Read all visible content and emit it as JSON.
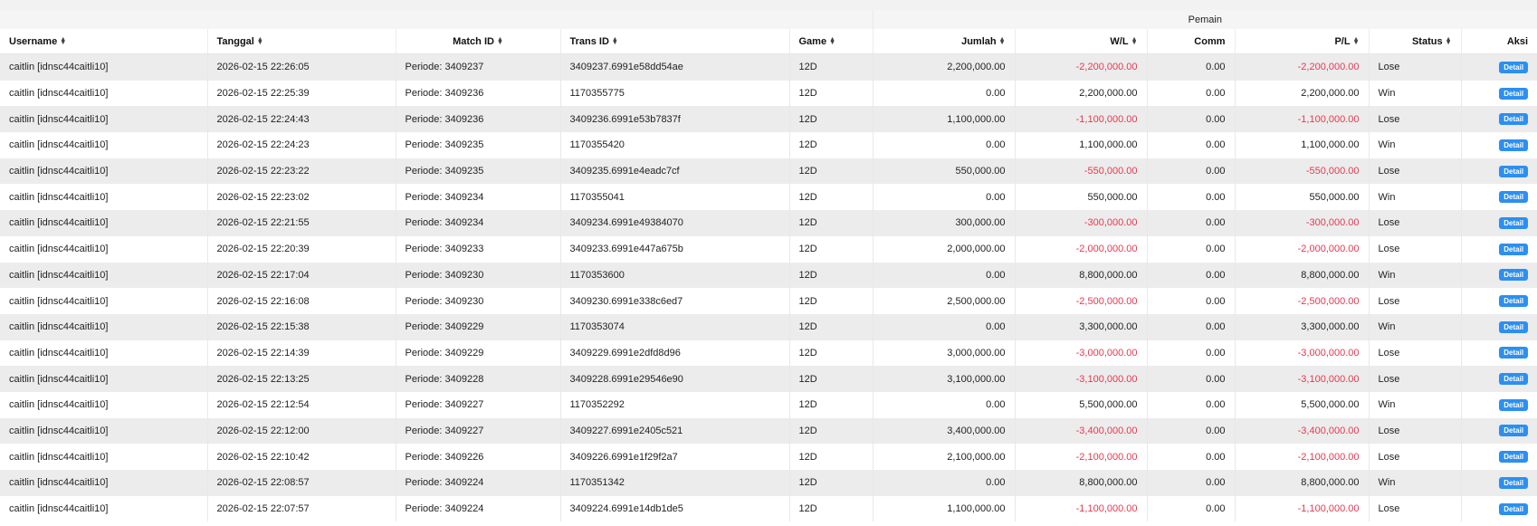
{
  "header_group": {
    "pemain": "Pemain"
  },
  "columns": [
    "Username",
    "Tanggal",
    "Match ID",
    "Trans ID",
    "Game",
    "Jumlah",
    "W/L",
    "Comm",
    "P/L",
    "Status",
    "Aksi"
  ],
  "sort_icon": "sort-icon",
  "colors": {
    "negative": "#e8384f",
    "detail_button": "#2d8ff0",
    "row_alt": "#ececec"
  },
  "rows": [
    {
      "username": "caitlin [idnsc44caitli10]",
      "tanggal": "2026-02-15 22:26:05",
      "match_id": "Periode: 3409237",
      "trans_id": "3409237.6991e58dd54ae",
      "game": "12D",
      "jumlah": "2,200,000.00",
      "wl": "-2,200,000.00",
      "comm": "0.00",
      "pl": "-2,200,000.00",
      "status": "Lose",
      "aksi": "Detail"
    },
    {
      "username": "caitlin [idnsc44caitli10]",
      "tanggal": "2026-02-15 22:25:39",
      "match_id": "Periode: 3409236",
      "trans_id": "1170355775",
      "game": "12D",
      "jumlah": "0.00",
      "wl": "2,200,000.00",
      "comm": "0.00",
      "pl": "2,200,000.00",
      "status": "Win",
      "aksi": "Detail"
    },
    {
      "username": "caitlin [idnsc44caitli10]",
      "tanggal": "2026-02-15 22:24:43",
      "match_id": "Periode: 3409236",
      "trans_id": "3409236.6991e53b7837f",
      "game": "12D",
      "jumlah": "1,100,000.00",
      "wl": "-1,100,000.00",
      "comm": "0.00",
      "pl": "-1,100,000.00",
      "status": "Lose",
      "aksi": "Detail"
    },
    {
      "username": "caitlin [idnsc44caitli10]",
      "tanggal": "2026-02-15 22:24:23",
      "match_id": "Periode: 3409235",
      "trans_id": "1170355420",
      "game": "12D",
      "jumlah": "0.00",
      "wl": "1,100,000.00",
      "comm": "0.00",
      "pl": "1,100,000.00",
      "status": "Win",
      "aksi": "Detail"
    },
    {
      "username": "caitlin [idnsc44caitli10]",
      "tanggal": "2026-02-15 22:23:22",
      "match_id": "Periode: 3409235",
      "trans_id": "3409235.6991e4eadc7cf",
      "game": "12D",
      "jumlah": "550,000.00",
      "wl": "-550,000.00",
      "comm": "0.00",
      "pl": "-550,000.00",
      "status": "Lose",
      "aksi": "Detail"
    },
    {
      "username": "caitlin [idnsc44caitli10]",
      "tanggal": "2026-02-15 22:23:02",
      "match_id": "Periode: 3409234",
      "trans_id": "1170355041",
      "game": "12D",
      "jumlah": "0.00",
      "wl": "550,000.00",
      "comm": "0.00",
      "pl": "550,000.00",
      "status": "Win",
      "aksi": "Detail"
    },
    {
      "username": "caitlin [idnsc44caitli10]",
      "tanggal": "2026-02-15 22:21:55",
      "match_id": "Periode: 3409234",
      "trans_id": "3409234.6991e49384070",
      "game": "12D",
      "jumlah": "300,000.00",
      "wl": "-300,000.00",
      "comm": "0.00",
      "pl": "-300,000.00",
      "status": "Lose",
      "aksi": "Detail"
    },
    {
      "username": "caitlin [idnsc44caitli10]",
      "tanggal": "2026-02-15 22:20:39",
      "match_id": "Periode: 3409233",
      "trans_id": "3409233.6991e447a675b",
      "game": "12D",
      "jumlah": "2,000,000.00",
      "wl": "-2,000,000.00",
      "comm": "0.00",
      "pl": "-2,000,000.00",
      "status": "Lose",
      "aksi": "Detail"
    },
    {
      "username": "caitlin [idnsc44caitli10]",
      "tanggal": "2026-02-15 22:17:04",
      "match_id": "Periode: 3409230",
      "trans_id": "1170353600",
      "game": "12D",
      "jumlah": "0.00",
      "wl": "8,800,000.00",
      "comm": "0.00",
      "pl": "8,800,000.00",
      "status": "Win",
      "aksi": "Detail"
    },
    {
      "username": "caitlin [idnsc44caitli10]",
      "tanggal": "2026-02-15 22:16:08",
      "match_id": "Periode: 3409230",
      "trans_id": "3409230.6991e338c6ed7",
      "game": "12D",
      "jumlah": "2,500,000.00",
      "wl": "-2,500,000.00",
      "comm": "0.00",
      "pl": "-2,500,000.00",
      "status": "Lose",
      "aksi": "Detail"
    },
    {
      "username": "caitlin [idnsc44caitli10]",
      "tanggal": "2026-02-15 22:15:38",
      "match_id": "Periode: 3409229",
      "trans_id": "1170353074",
      "game": "12D",
      "jumlah": "0.00",
      "wl": "3,300,000.00",
      "comm": "0.00",
      "pl": "3,300,000.00",
      "status": "Win",
      "aksi": "Detail"
    },
    {
      "username": "caitlin [idnsc44caitli10]",
      "tanggal": "2026-02-15 22:14:39",
      "match_id": "Periode: 3409229",
      "trans_id": "3409229.6991e2dfd8d96",
      "game": "12D",
      "jumlah": "3,000,000.00",
      "wl": "-3,000,000.00",
      "comm": "0.00",
      "pl": "-3,000,000.00",
      "status": "Lose",
      "aksi": "Detail"
    },
    {
      "username": "caitlin [idnsc44caitli10]",
      "tanggal": "2026-02-15 22:13:25",
      "match_id": "Periode: 3409228",
      "trans_id": "3409228.6991e29546e90",
      "game": "12D",
      "jumlah": "3,100,000.00",
      "wl": "-3,100,000.00",
      "comm": "0.00",
      "pl": "-3,100,000.00",
      "status": "Lose",
      "aksi": "Detail"
    },
    {
      "username": "caitlin [idnsc44caitli10]",
      "tanggal": "2026-02-15 22:12:54",
      "match_id": "Periode: 3409227",
      "trans_id": "1170352292",
      "game": "12D",
      "jumlah": "0.00",
      "wl": "5,500,000.00",
      "comm": "0.00",
      "pl": "5,500,000.00",
      "status": "Win",
      "aksi": "Detail"
    },
    {
      "username": "caitlin [idnsc44caitli10]",
      "tanggal": "2026-02-15 22:12:00",
      "match_id": "Periode: 3409227",
      "trans_id": "3409227.6991e2405c521",
      "game": "12D",
      "jumlah": "3,400,000.00",
      "wl": "-3,400,000.00",
      "comm": "0.00",
      "pl": "-3,400,000.00",
      "status": "Lose",
      "aksi": "Detail"
    },
    {
      "username": "caitlin [idnsc44caitli10]",
      "tanggal": "2026-02-15 22:10:42",
      "match_id": "Periode: 3409226",
      "trans_id": "3409226.6991e1f29f2a7",
      "game": "12D",
      "jumlah": "2,100,000.00",
      "wl": "-2,100,000.00",
      "comm": "0.00",
      "pl": "-2,100,000.00",
      "status": "Lose",
      "aksi": "Detail"
    },
    {
      "username": "caitlin [idnsc44caitli10]",
      "tanggal": "2026-02-15 22:08:57",
      "match_id": "Periode: 3409224",
      "trans_id": "1170351342",
      "game": "12D",
      "jumlah": "0.00",
      "wl": "8,800,000.00",
      "comm": "0.00",
      "pl": "8,800,000.00",
      "status": "Win",
      "aksi": "Detail"
    },
    {
      "username": "caitlin [idnsc44caitli10]",
      "tanggal": "2026-02-15 22:07:57",
      "match_id": "Periode: 3409224",
      "trans_id": "3409224.6991e14db1de5",
      "game": "12D",
      "jumlah": "1,100,000.00",
      "wl": "-1,100,000.00",
      "comm": "0.00",
      "pl": "-1,100,000.00",
      "status": "Lose",
      "aksi": "Detail"
    }
  ]
}
